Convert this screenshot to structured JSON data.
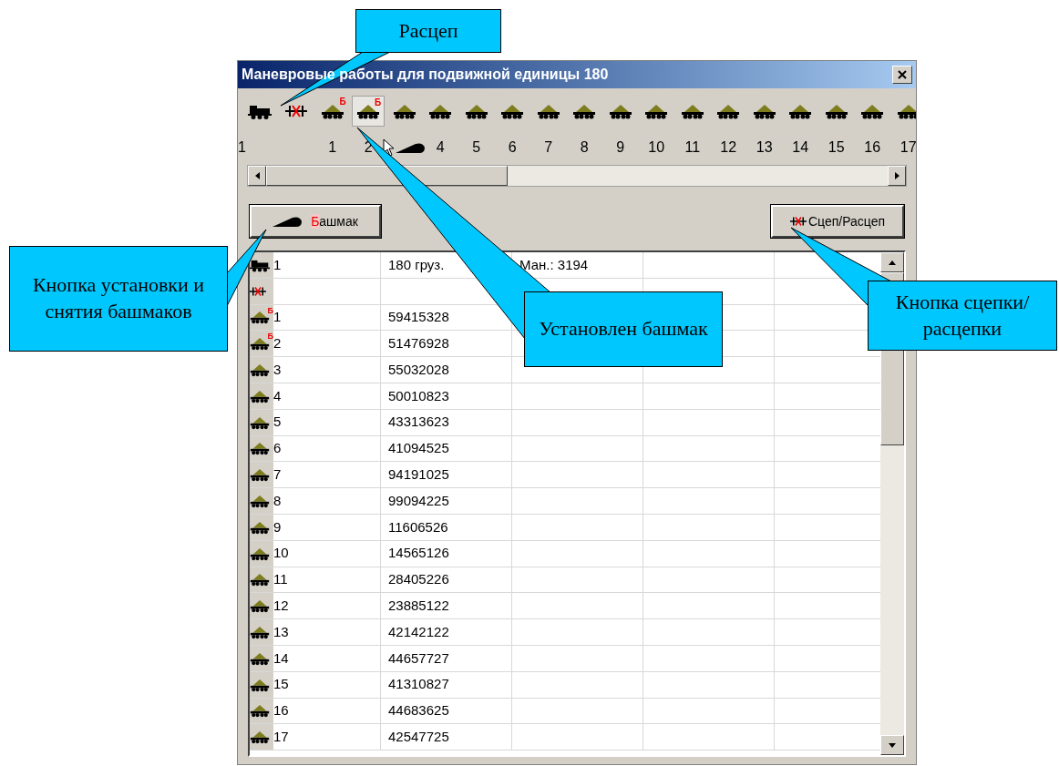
{
  "window": {
    "title": "Маневровые работы для подвижной единицы 180"
  },
  "strip": {
    "items": [
      {
        "kind": "locomotive",
        "label": "1",
        "selected": false
      },
      {
        "kind": "coupler",
        "selected": false
      },
      {
        "kind": "wagon",
        "label": "1",
        "badge": "Б",
        "selected": false
      },
      {
        "kind": "wagon",
        "label": "2",
        "badge": "Б",
        "selected": true
      },
      {
        "kind": "wagon",
        "drag_cursor": true,
        "selected": false
      },
      {
        "kind": "wagon",
        "label": "4",
        "selected": false
      },
      {
        "kind": "wagon",
        "label": "5",
        "selected": false
      },
      {
        "kind": "wagon",
        "label": "6",
        "selected": false
      },
      {
        "kind": "wagon",
        "label": "7",
        "selected": false
      },
      {
        "kind": "wagon",
        "label": "8",
        "selected": false
      },
      {
        "kind": "wagon",
        "label": "9",
        "selected": false
      },
      {
        "kind": "wagon",
        "label": "10",
        "selected": false
      },
      {
        "kind": "wagon",
        "label": "11",
        "selected": false
      },
      {
        "kind": "wagon",
        "label": "12",
        "selected": false
      },
      {
        "kind": "wagon",
        "label": "13",
        "selected": false
      },
      {
        "kind": "wagon",
        "label": "14",
        "selected": false
      },
      {
        "kind": "wagon",
        "label": "15",
        "selected": false
      },
      {
        "kind": "wagon",
        "label": "16",
        "selected": false
      },
      {
        "kind": "wagon",
        "label": "17",
        "selected": false
      }
    ]
  },
  "buttons": {
    "shoe": "Башмак",
    "couple": "Сцеп/Расцеп"
  },
  "table": {
    "rows": [
      {
        "kind": "locomotive",
        "number": "1",
        "column_2": "180 груз.",
        "column_3": "Ман.: 3194"
      },
      {
        "kind": "coupler"
      },
      {
        "kind": "wagon",
        "number": "1",
        "badge": "Б",
        "column_2": "59415328"
      },
      {
        "kind": "wagon",
        "number": "2",
        "badge": "Б",
        "column_2": "51476928"
      },
      {
        "kind": "wagon",
        "number": "3",
        "column_2": "55032028"
      },
      {
        "kind": "wagon",
        "number": "4",
        "column_2": "50010823"
      },
      {
        "kind": "wagon",
        "number": "5",
        "column_2": "43313623"
      },
      {
        "kind": "wagon",
        "number": "6",
        "column_2": "41094525"
      },
      {
        "kind": "wagon",
        "number": "7",
        "column_2": "94191025"
      },
      {
        "kind": "wagon",
        "number": "8",
        "column_2": "99094225"
      },
      {
        "kind": "wagon",
        "number": "9",
        "column_2": "11606526"
      },
      {
        "kind": "wagon",
        "number": "10",
        "column_2": "14565126"
      },
      {
        "kind": "wagon",
        "number": "11",
        "column_2": "28405226"
      },
      {
        "kind": "wagon",
        "number": "12",
        "column_2": "23885122"
      },
      {
        "kind": "wagon",
        "number": "13",
        "column_2": "42142122"
      },
      {
        "kind": "wagon",
        "number": "14",
        "column_2": "44657727"
      },
      {
        "kind": "wagon",
        "number": "15",
        "column_2": "41310827"
      },
      {
        "kind": "wagon",
        "number": "16",
        "column_2": "44683625"
      },
      {
        "kind": "wagon",
        "number": "17",
        "column_2": "42547725"
      }
    ]
  },
  "callouts": [
    {
      "text": "Расцеп"
    },
    {
      "text": "Кнопка установки и снятия башмаков"
    },
    {
      "text": "Установлен башмак"
    },
    {
      "text": "Кнопка сцепки/расцепки"
    }
  ]
}
